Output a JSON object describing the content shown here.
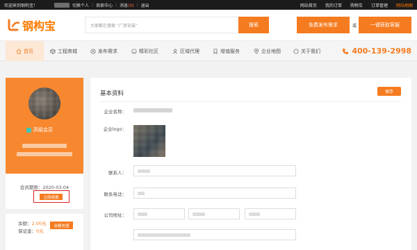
{
  "topbar": {
    "welcome": "欢迎来到钢构宝！",
    "switch_personal": "切换个人",
    "merchant_center": "商家中心",
    "messages_label": "消息",
    "messages_count": "(0)",
    "logout": "退出",
    "links": [
      "网站首页",
      "我的订单",
      "购物车",
      "订单管理",
      "网站地图"
    ]
  },
  "header": {
    "logo_text": "钢构宝",
    "search_placeholder": "大家都在搜索 “厂房安装”",
    "search_button": "搜索",
    "publish_button": "免费发布需求",
    "or_text": "或",
    "service_button": "一键获取客服"
  },
  "nav": {
    "items": [
      "首页",
      "工程商城",
      "发布需求",
      "精彩社区",
      "区域代理",
      "增值服务",
      "企业地图",
      "关于我们"
    ],
    "hotline": "400-139-2998",
    "icons": [
      "home-icon",
      "cube-icon",
      "plus-circle-icon",
      "smile-icon",
      "person-icon",
      "bookmark-icon",
      "pin-icon",
      "face-icon"
    ]
  },
  "sidebar": {
    "member_level": "高级会员",
    "expire_label": "会员期限：",
    "expire_date": "2020-03-04",
    "renew_button": "立即续费",
    "balance_label": "余额：",
    "balance_value": "2.00元",
    "deposit_label": "保证金：",
    "deposit_value": "0元",
    "recharge_button": "余额充值"
  },
  "main": {
    "title": "基本资料",
    "save_button": "保存",
    "company_name_label": "企业名称：",
    "company_logo_label": "企业logo：",
    "contact_label": "联系人：",
    "phone_label": "联系电话：",
    "address_label": "公司地址："
  },
  "colors": {
    "accent": "#f57b20",
    "topbar": "#1b1b1b",
    "renew_outline": "#e02020"
  }
}
